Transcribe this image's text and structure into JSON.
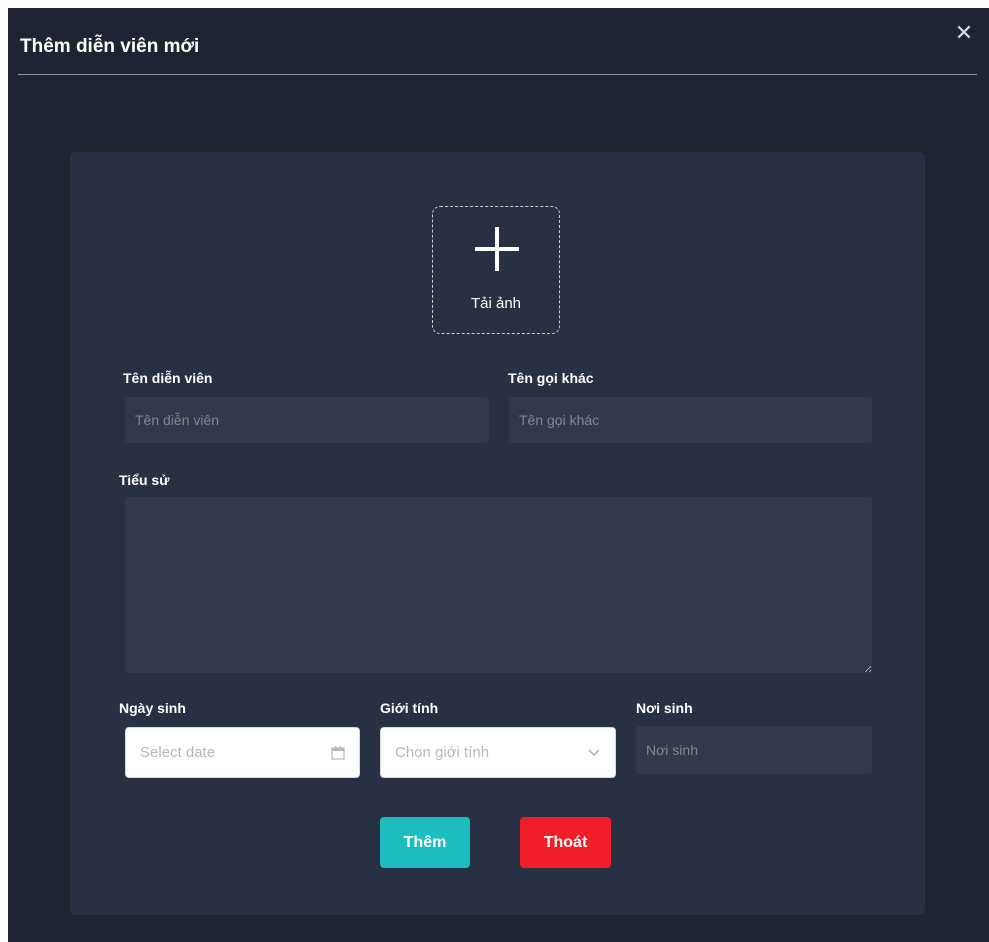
{
  "modal": {
    "title": "Thêm diễn viên mới",
    "close_icon": "close-icon"
  },
  "upload": {
    "label": "Tải ảnh",
    "icon": "plus-icon"
  },
  "fields": {
    "actor_name": {
      "label": "Tên diễn viên",
      "placeholder": "Tên diễn viên",
      "value": ""
    },
    "alias": {
      "label": "Tên gọi khác",
      "placeholder": "Tên gọi khác",
      "value": ""
    },
    "biography": {
      "label": "Tiểu sử",
      "value": ""
    },
    "birth_date": {
      "label": "Ngày sinh",
      "placeholder": "Select date",
      "icon": "calendar-icon"
    },
    "gender": {
      "label": "Giới tính",
      "placeholder": "Chọn giới tính",
      "icon": "chevron-down-icon"
    },
    "birth_place": {
      "label": "Nơi sinh",
      "placeholder": "Nơi sinh",
      "value": ""
    }
  },
  "buttons": {
    "add": "Thêm",
    "exit": "Thoát"
  },
  "colors": {
    "modal_bg": "#1e2431",
    "card_bg": "#283143",
    "input_bg": "#313a4c",
    "add_button": "#1dbdbf",
    "exit_button": "#f01e29"
  }
}
